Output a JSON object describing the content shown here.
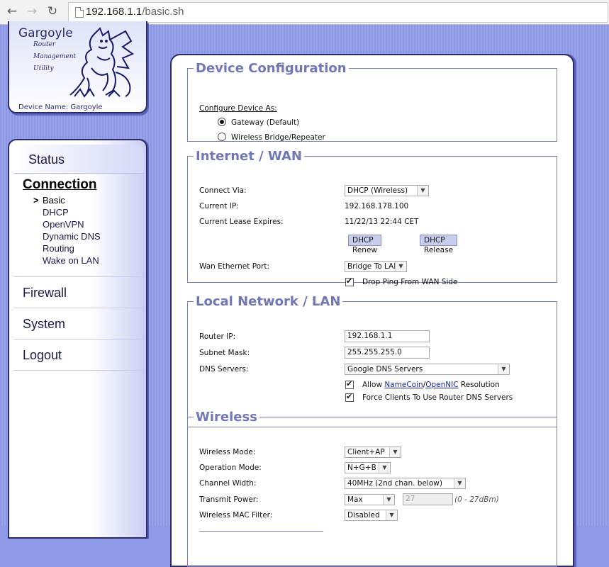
{
  "browser": {
    "back_icon": "arrow-left-icon",
    "forward_icon": "arrow-right-icon",
    "reload_icon": "reload-icon",
    "url_host": "192.168.1.1",
    "url_path": "/basic.sh"
  },
  "logo": {
    "title": "Gargoyle",
    "sub1": "Router",
    "sub2": "Management",
    "sub3": "Utility",
    "device_name": "Device Name: Gargoyle"
  },
  "nav": {
    "status": "Status",
    "connection": "Connection",
    "sub_items": [
      {
        "label": "Basic",
        "active": true
      },
      {
        "label": "DHCP"
      },
      {
        "label": "OpenVPN"
      },
      {
        "label": "Dynamic DNS"
      },
      {
        "label": "Routing"
      },
      {
        "label": "Wake on LAN"
      }
    ],
    "active_marker": ">",
    "firewall": "Firewall",
    "system": "System",
    "logout": "Logout"
  },
  "device_config": {
    "legend": "Device Configuration",
    "configure_as": "Configure Device As:",
    "option_gateway": "Gateway (Default)",
    "option_bridge": "Wireless Bridge/Repeater",
    "selected": "Gateway (Default)"
  },
  "wan": {
    "legend": "Internet / WAN",
    "connect_via_label": "Connect Via:",
    "connect_via_value": "DHCP (Wireless)",
    "current_ip_label": "Current IP:",
    "current_ip_value": "192.168.178.100",
    "lease_label": "Current Lease Expires:",
    "lease_value": "11/22/13 22:44 CET",
    "renew_button": "DHCP Renew",
    "release_button": "DHCP Release",
    "eth_port_label": "Wan Ethernet Port:",
    "eth_port_value": "Bridge To LAN",
    "drop_ping_label": "Drop Ping From WAN Side",
    "drop_ping_checked": true
  },
  "lan": {
    "legend": "Local Network / LAN",
    "router_ip_label": "Router IP:",
    "router_ip_value": "192.168.1.1",
    "subnet_label": "Subnet Mask:",
    "subnet_value": "255.255.255.0",
    "dns_label": "DNS Servers:",
    "dns_value": "Google DNS Servers",
    "allow_prefix": "Allow ",
    "namecoin_link": "NameCoin",
    "slash": "/",
    "opennic_link": "OpenNIC",
    "allow_suffix": " Resolution",
    "force_dns_label": "Force Clients To Use Router DNS Servers"
  },
  "wireless": {
    "legend": "Wireless",
    "mode_label": "Wireless Mode:",
    "mode_value": "Client+AP",
    "op_mode_label": "Operation Mode:",
    "op_mode_value": "N+G+B",
    "width_label": "Channel Width:",
    "width_value": "40MHz (2nd chan. below)",
    "power_label": "Transmit Power:",
    "power_value": "Max",
    "power_input": "27",
    "power_note": "(0 - 27dBm)",
    "mac_label": "Wireless MAC Filter:",
    "mac_value": "Disabled"
  }
}
